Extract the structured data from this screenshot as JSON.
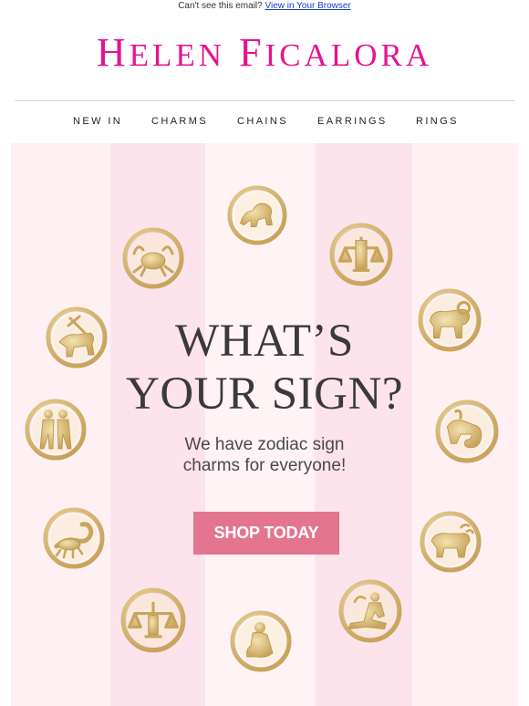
{
  "preheader": {
    "text": "Can't see this email?",
    "link": "View in Your Browser"
  },
  "brand": {
    "first_initial": "H",
    "first_rest": "ELEN",
    "last_initial": "F",
    "last_rest": "ICALORA"
  },
  "nav": {
    "items": [
      {
        "label": "NEW IN"
      },
      {
        "label": "CHARMS"
      },
      {
        "label": "CHAINS"
      },
      {
        "label": "EARRINGS"
      },
      {
        "label": "RINGS"
      }
    ]
  },
  "hero": {
    "headline_line1": "WHAT’S",
    "headline_line2": "YOUR SIGN?",
    "sub_line1": "We have zodiac sign",
    "sub_line2": "charms for everyone!",
    "cta_label": "SHOP TODAY",
    "charms": [
      "leo",
      "cancer",
      "libra",
      "sagittarius",
      "aries",
      "gemini",
      "capricorn",
      "scorpio",
      "taurus",
      "libra",
      "virgo",
      "aquarius"
    ]
  },
  "colors": {
    "brand_pink": "#e6138f",
    "cta_pink": "#e4758e",
    "stripe_light": "#fff0f4",
    "stripe_dark": "#fde3ec",
    "gold": "#d9bd78",
    "link_blue": "#1a3cc8"
  }
}
